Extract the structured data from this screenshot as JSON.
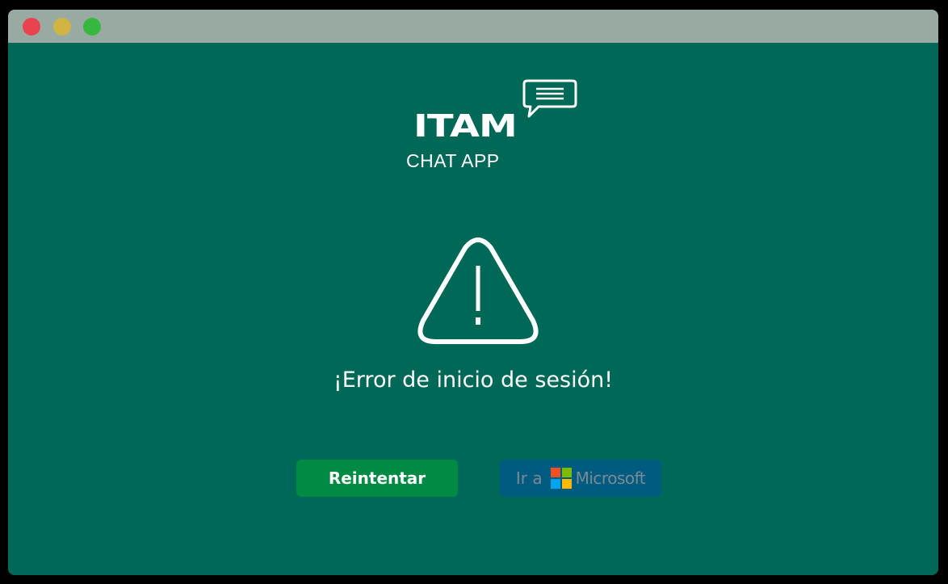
{
  "window": {
    "controls": [
      "close",
      "minimize",
      "maximize"
    ],
    "colors": {
      "close": "#e8434e",
      "minimize": "#d1b441",
      "maximize": "#36b83f",
      "titlebar": "#99aaa3",
      "background": "#006856"
    }
  },
  "logo": {
    "word": "ITAM",
    "subtitle": "CHAT APP",
    "icon": "chat-bubble-icon"
  },
  "status": {
    "icon": "warning-icon",
    "message": "¡Error de inicio de sesión!"
  },
  "actions": {
    "retry_label": "Reintentar",
    "microsoft_prefix": "Ir a",
    "microsoft_name": "Microsoft",
    "microsoft_icon": "microsoft-logo-icon",
    "colors": {
      "retry": "#008a43",
      "microsoft": "#005b80"
    }
  }
}
